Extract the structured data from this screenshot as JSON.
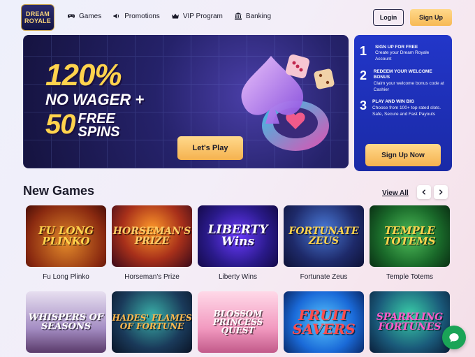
{
  "brand": {
    "logo_line1": "DREAM",
    "logo_line2": "ROYALE"
  },
  "nav": [
    {
      "label": "Games",
      "icon": "gamepad-icon"
    },
    {
      "label": "Promotions",
      "icon": "megaphone-icon"
    },
    {
      "label": "VIP Program",
      "icon": "crown-icon"
    },
    {
      "label": "Banking",
      "icon": "bank-icon"
    }
  ],
  "header": {
    "login_label": "Login",
    "signup_label": "Sign Up"
  },
  "hero": {
    "line1": "120%",
    "line2": "NO WAGER +",
    "line3": "50",
    "line4a": "FREE",
    "line4b": "SPINS",
    "cta_label": "Let's Play"
  },
  "steps": {
    "items": [
      {
        "num": "1",
        "title": "SIGN UP FOR FREE",
        "desc": "Create your Dream Royale Account"
      },
      {
        "num": "2",
        "title": "REDEEM YOUR WELCOME BONUS",
        "desc": "Claim your welcome bonus code at Cashier"
      },
      {
        "num": "3",
        "title": "PLAY AND WIN BIG",
        "desc": "Choose from 100+ top rated slots. Safe, Secure and Fast Payouts"
      }
    ],
    "cta_label": "Sign Up Now"
  },
  "new_games": {
    "title": "New Games",
    "view_all": "View All",
    "row1": [
      {
        "name": "Fu Long Plinko",
        "logo": "FU LONG PLINKO"
      },
      {
        "name": "Horseman's Prize",
        "logo": "HORSEMAN'S PRIZE"
      },
      {
        "name": "Liberty Wins",
        "logo": "LIBERTY Wins"
      },
      {
        "name": "Fortunate Zeus",
        "logo": "FORTUNATE ZEUS"
      },
      {
        "name": "Temple Totems",
        "logo": "TEMPLE TOTEMS"
      }
    ],
    "row2": [
      {
        "logo": "WHISPERS OF SEASONS"
      },
      {
        "logo": "HADES' FLAMES OF FORTUNE"
      },
      {
        "logo": "BLOSSOM PRINCESS QUEST"
      },
      {
        "logo": "FRUIT SAVERS"
      },
      {
        "logo": "SPARKLING FORTUNES"
      }
    ]
  },
  "colors": {
    "accent": "#f7b955",
    "panel_blue": "#1f33bf",
    "chat_green": "#1aa457"
  }
}
